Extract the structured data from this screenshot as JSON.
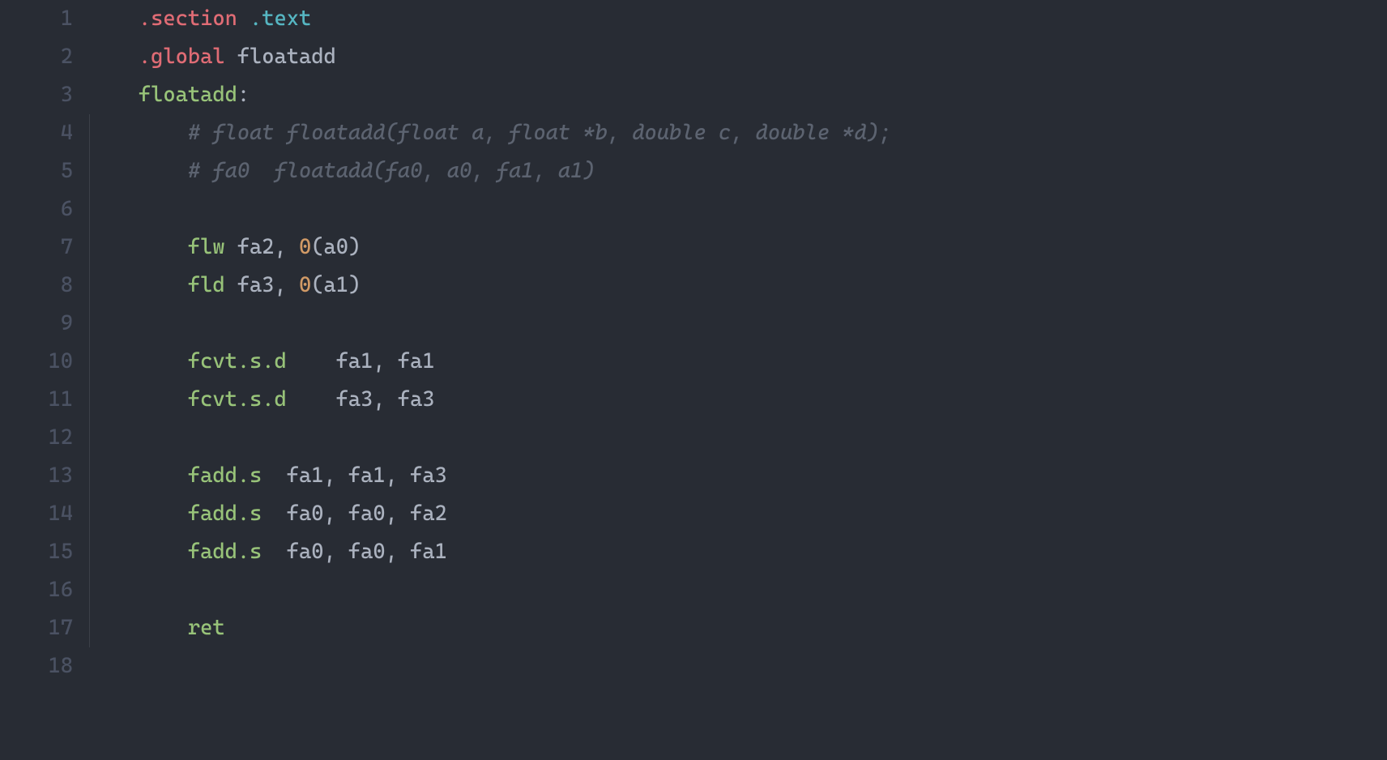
{
  "gutter": {
    "lines": [
      "1",
      "2",
      "3",
      "4",
      "5",
      "6",
      "7",
      "8",
      "9",
      "10",
      "11",
      "12",
      "13",
      "14",
      "15",
      "16",
      "17",
      "18"
    ]
  },
  "code": {
    "l1": {
      "directive": ".section",
      "section": " .text"
    },
    "l2": {
      "directive": ".global",
      "label": " floatadd"
    },
    "l3": {
      "label": "floatadd",
      "colon": ":"
    },
    "l4": {
      "comment": "# float floatadd(float a, float *b, double c, double *d);"
    },
    "l5": {
      "comment": "# fa0  floatadd(fa0, a0, fa1, a1)"
    },
    "l7": {
      "instr": "flw",
      "args": " fa2, ",
      "num": "0",
      "paren_open": "(",
      "reg": "a0",
      "paren_close": ")"
    },
    "l8": {
      "instr": "fld",
      "args": " fa3, ",
      "num": "0",
      "paren_open": "(",
      "reg": "a1",
      "paren_close": ")"
    },
    "l10": {
      "instr": "fcvt.s.d",
      "args": "    fa1, fa1"
    },
    "l11": {
      "instr": "fcvt.s.d",
      "args": "    fa3, fa3"
    },
    "l13": {
      "instr": "fadd.s",
      "args": "  fa1, fa1, fa3"
    },
    "l14": {
      "instr": "fadd.s",
      "args": "  fa0, fa0, fa2"
    },
    "l15": {
      "instr": "fadd.s",
      "args": "  fa0, fa0, fa1"
    },
    "l17": {
      "instr": "ret"
    }
  }
}
